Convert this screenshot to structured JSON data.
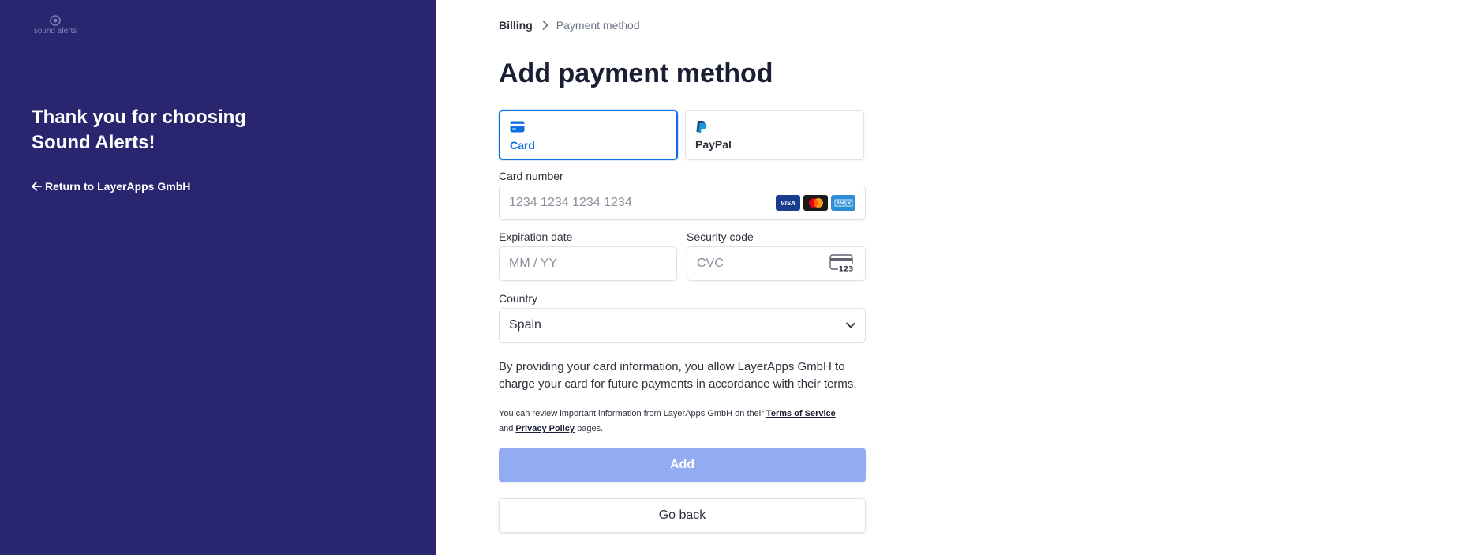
{
  "brand": {
    "logo_text": "sound alerts"
  },
  "left_panel": {
    "heading": "Thank you for choosing Sound Alerts!",
    "return_link": "Return to LayerApps GmbH"
  },
  "breadcrumb": {
    "parent": "Billing",
    "current": "Payment method"
  },
  "page_title": "Add payment method",
  "tabs": [
    {
      "label": "Card",
      "icon": "credit-card-icon",
      "selected": true
    },
    {
      "label": "PayPal",
      "icon": "paypal-icon",
      "selected": false
    }
  ],
  "form": {
    "card_number": {
      "label": "Card number",
      "placeholder": "1234 1234 1234 1234",
      "brands": [
        "VISA",
        "Mastercard",
        "American Express"
      ]
    },
    "expiry": {
      "label": "Expiration date",
      "placeholder": "MM / YY"
    },
    "cvc": {
      "label": "Security code",
      "placeholder": "CVC",
      "icon_text": "123"
    },
    "country": {
      "label": "Country",
      "value": "Spain"
    }
  },
  "disclaimer": "By providing your card information, you allow LayerApps GmbH to charge your card for future payments in accordance with their terms.",
  "terms": {
    "prefix": "You can review important information from LayerApps GmbH on their ",
    "terms_link": "Terms of Service",
    "middle": "and ",
    "privacy_link": "Privacy Policy",
    "suffix": " pages."
  },
  "buttons": {
    "add": "Add",
    "back": "Go back"
  },
  "colors": {
    "sidebar_bg": "#29266f",
    "accent": "#0a6de0",
    "add_button_bg": "#93abf3"
  }
}
